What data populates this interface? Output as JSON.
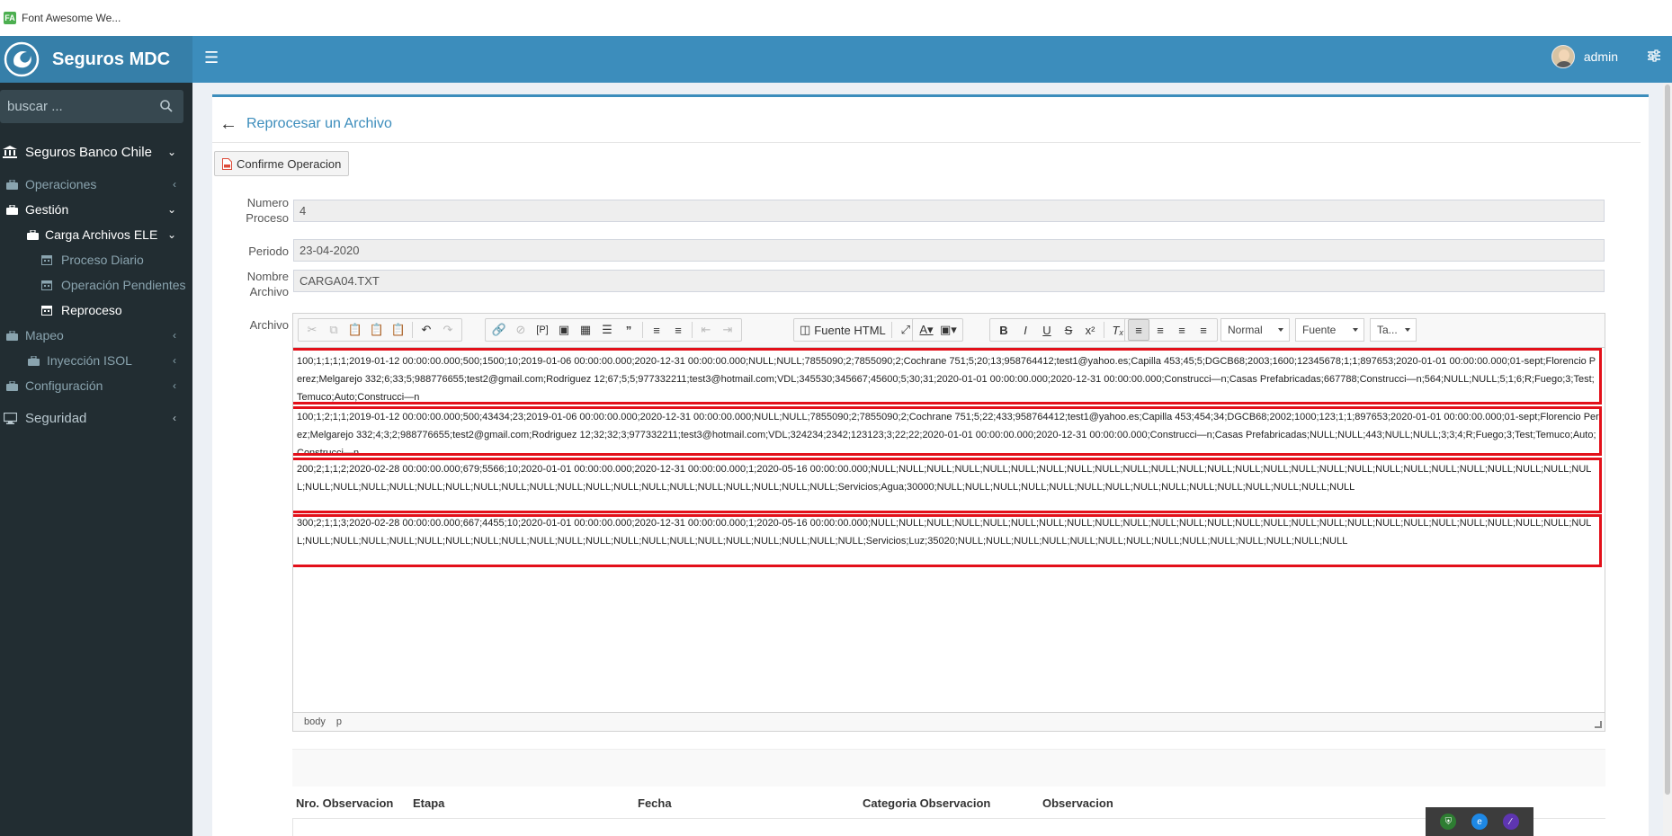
{
  "browser": {
    "tab_title": "Font Awesome We..."
  },
  "header": {
    "app_name": "Seguros MDC",
    "user_name": "admin"
  },
  "sidebar": {
    "search_placeholder": "buscar ...",
    "items": [
      {
        "label": "Seguros Banco Chile",
        "level": 0,
        "icon": "bank-icon"
      },
      {
        "label": "Operaciones",
        "level": 1,
        "icon": "briefcase-icon"
      },
      {
        "label": "Gestión",
        "level": 1,
        "icon": "briefcase-icon",
        "active": true
      },
      {
        "label": "Carga Archivos ELE",
        "level": 2,
        "icon": "briefcase-icon"
      },
      {
        "label": "Proceso Diario",
        "level": 3,
        "icon": "calendar-icon"
      },
      {
        "label": "Operación Pendientes",
        "level": 3,
        "icon": "calendar-icon"
      },
      {
        "label": "Reproceso",
        "level": 3,
        "icon": "calendar-icon",
        "active": true
      },
      {
        "label": "Mapeo",
        "level": 1,
        "icon": "briefcase-icon"
      },
      {
        "label": "Inyección ISOL",
        "level": 1,
        "icon": "briefcase-icon"
      },
      {
        "label": "Configuración",
        "level": 1,
        "icon": "briefcase-icon"
      },
      {
        "label": "Seguridad",
        "level": 0,
        "icon": "desktop-icon"
      }
    ]
  },
  "page": {
    "title": "Reprocesar un Archivo",
    "confirm_button": "Confirme Operacion"
  },
  "form": {
    "numero_proceso_label": "Numero Proceso",
    "numero_proceso_value": "4",
    "periodo_label": "Periodo",
    "periodo_value": "23-04-2020",
    "nombre_archivo_label": "Nombre Archivo",
    "nombre_archivo_value": "CARGA04.TXT",
    "archivo_label": "Archivo"
  },
  "editor": {
    "toolbar": {
      "source_label": "Fuente HTML",
      "format_combo": "Normal",
      "font_combo": "Fuente",
      "size_combo": "Ta..."
    },
    "records": [
      "100;1;1;1;1;2019-01-12 00:00:00.000;500;1500;10;2019-01-06 00:00:00.000;2020-12-31 00:00:00.000;NULL;NULL;7855090;2;7855090;2;Cochrane 751;5;20;13;958764412;test1@yahoo.es;Capilla 453;45;5;DGCB68;2003;1600;12345678;1;1;897653;2020-01-01 00:00:00.000;01-sept;Florencio Perez;Melgarejo 332;6;33;5;988776655;test2@gmail.com;Rodriguez 12;67;5;5;977332211;test3@hotmail.com;VDL;345530;345667;45600;5;30;31;2020-01-01 00:00:00.000;2020-12-31 00:00:00.000;Construcci—n;Casas Prefabricadas;667788;Construcci—n;564;NULL;NULL;5;1;6;R;Fuego;3;Test;Temuco;Auto;Construcci—n",
      "100;1;2;1;1;2019-01-12 00:00:00.000;500;43434;23;2019-01-06 00:00:00.000;2020-12-31 00:00:00.000;NULL;NULL;7855090;2;7855090;2;Cochrane 751;5;22;433;958764412;test1@yahoo.es;Capilla 453;454;34;DGCB68;2002;1000;123;1;1;897653;2020-01-01 00:00:00.000;01-sept;Florencio Perez;Melgarejo 332;4;3;2;988776655;test2@gmail.com;Rodriguez 12;32;32;3;977332211;test3@hotmail.com;VDL;324234;2342;123123;3;22;22;2020-01-01 00:00:00.000;2020-12-31 00:00:00.000;Construcci—n;Casas Prefabricadas;NULL;NULL;443;NULL;NULL;3;3;4;R;Fuego;3;Test;Temuco;Auto;Construcci—n",
      "200;2;1;1;2;2020-02-28 00:00:00.000;679;5566;10;2020-01-01 00:00:00.000;2020-12-31 00:00:00.000;1;2020-05-16 00:00:00.000;NULL;NULL;NULL;NULL;NULL;NULL;NULL;NULL;NULL;NULL;NULL;NULL;NULL;NULL;NULL;NULL;NULL;NULL;NULL;NULL;NULL;NULL;NULL;NULL;NULL;NULL;NULL;NULL;NULL;NULL;NULL;NULL;NULL;NULL;NULL;NULL;NULL;NULL;NULL;NULL;NULL;NULL;NULL;NULL;NULL;Servicios;Agua;30000;NULL;NULL;NULL;NULL;NULL;NULL;NULL;NULL;NULL;NULL;NULL;NULL;NULL;NULL;NULL",
      "300;2;1;1;3;2020-02-28 00:00:00.000;667;4455;10;2020-01-01 00:00:00.000;2020-12-31 00:00:00.000;1;2020-05-16 00:00:00.000;NULL;NULL;NULL;NULL;NULL;NULL;NULL;NULL;NULL;NULL;NULL;NULL;NULL;NULL;NULL;NULL;NULL;NULL;NULL;NULL;NULL;NULL;NULL;NULL;NULL;NULL;NULL;NULL;NULL;NULL;NULL;NULL;NULL;NULL;NULL;NULL;NULL;NULL;NULL;NULL;NULL;NULL;NULL;NULL;NULL;NULL;Servicios;Luz;35020;NULL;NULL;NULL;NULL;NULL;NULL;NULL;NULL;NULL;NULL;NULL;NULL;NULL;NULL"
    ],
    "status_path": [
      "body",
      "p"
    ]
  },
  "observations": {
    "columns": [
      "Nro. Observacion",
      "Etapa",
      "Fecha",
      "Categoria Observacion",
      "Observacion"
    ]
  },
  "colors": {
    "header_blue": "#3c8dbc",
    "logo_blue": "#367fa9",
    "sidebar_dark": "#222d32",
    "highlight_red": "#e3101a"
  }
}
